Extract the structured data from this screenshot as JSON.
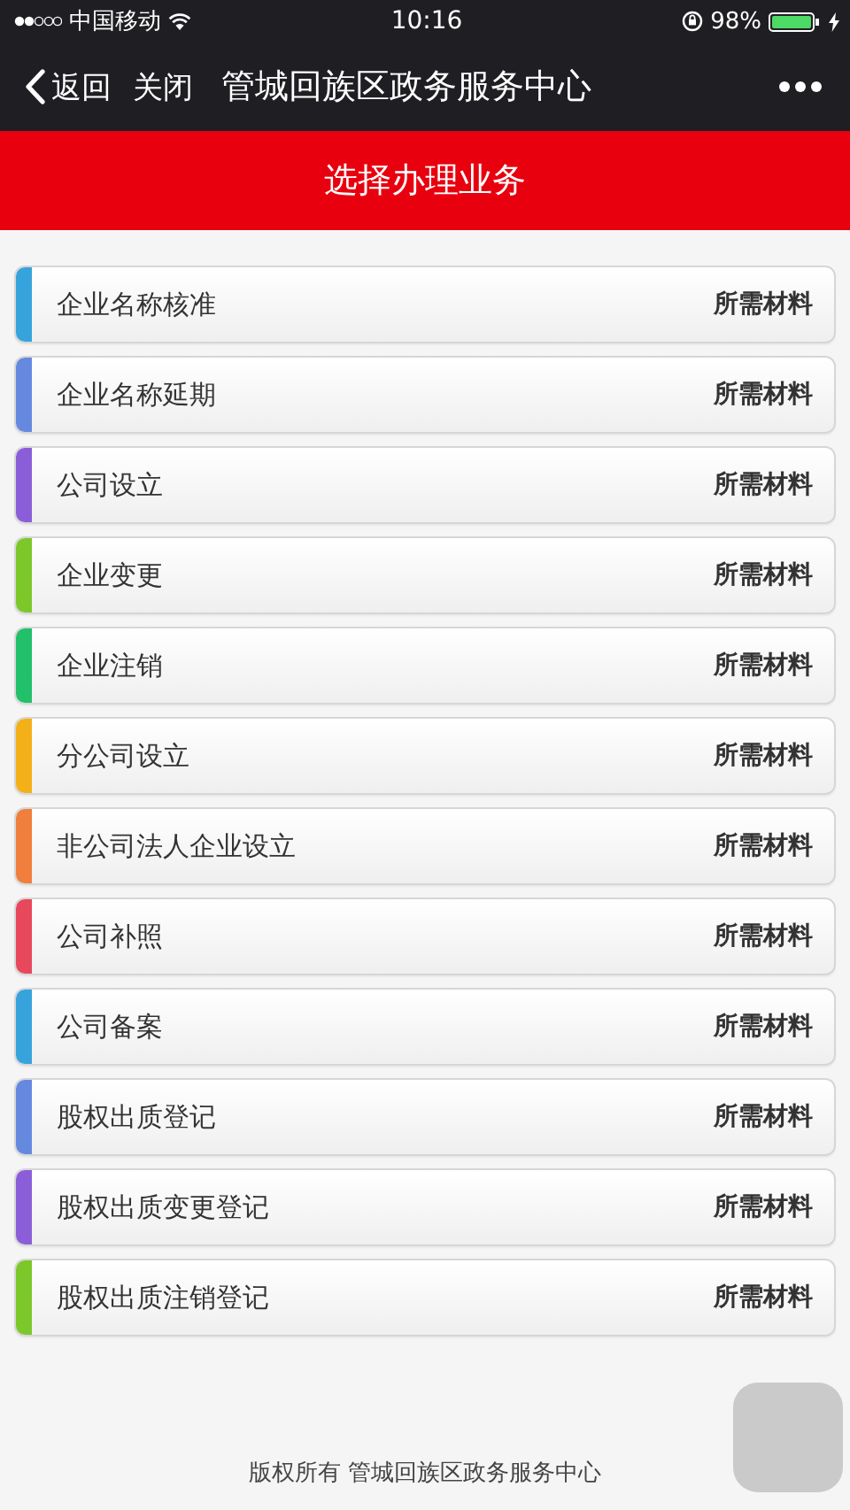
{
  "status_bar": {
    "carrier": "中国移动",
    "time": "10:16",
    "battery": "98%"
  },
  "nav_bar": {
    "back": "返回",
    "close": "关闭",
    "title": "管城回族区政务服务中心"
  },
  "header": {
    "title": "选择办理业务"
  },
  "items": [
    {
      "name": "企业名称核准",
      "action": "所需材料",
      "color": "#36a3dc"
    },
    {
      "name": "企业名称延期",
      "action": "所需材料",
      "color": "#6689e0"
    },
    {
      "name": "公司设立",
      "action": "所需材料",
      "color": "#8a5ed8"
    },
    {
      "name": "企业变更",
      "action": "所需材料",
      "color": "#7cc82a"
    },
    {
      "name": "企业注销",
      "action": "所需材料",
      "color": "#22c06a"
    },
    {
      "name": "分公司设立",
      "action": "所需材料",
      "color": "#f4b018"
    },
    {
      "name": "非公司法人企业设立",
      "action": "所需材料",
      "color": "#f07e3c"
    },
    {
      "name": "公司补照",
      "action": "所需材料",
      "color": "#e8485c"
    },
    {
      "name": "公司备案",
      "action": "所需材料",
      "color": "#36a3dc"
    },
    {
      "name": "股权出质登记",
      "action": "所需材料",
      "color": "#6689e0"
    },
    {
      "name": "股权出质变更登记",
      "action": "所需材料",
      "color": "#8a5ed8"
    },
    {
      "name": "股权出质注销登记",
      "action": "所需材料",
      "color": "#7cc82a"
    }
  ],
  "footer": {
    "text": "版权所有 管城回族区政务服务中心"
  }
}
